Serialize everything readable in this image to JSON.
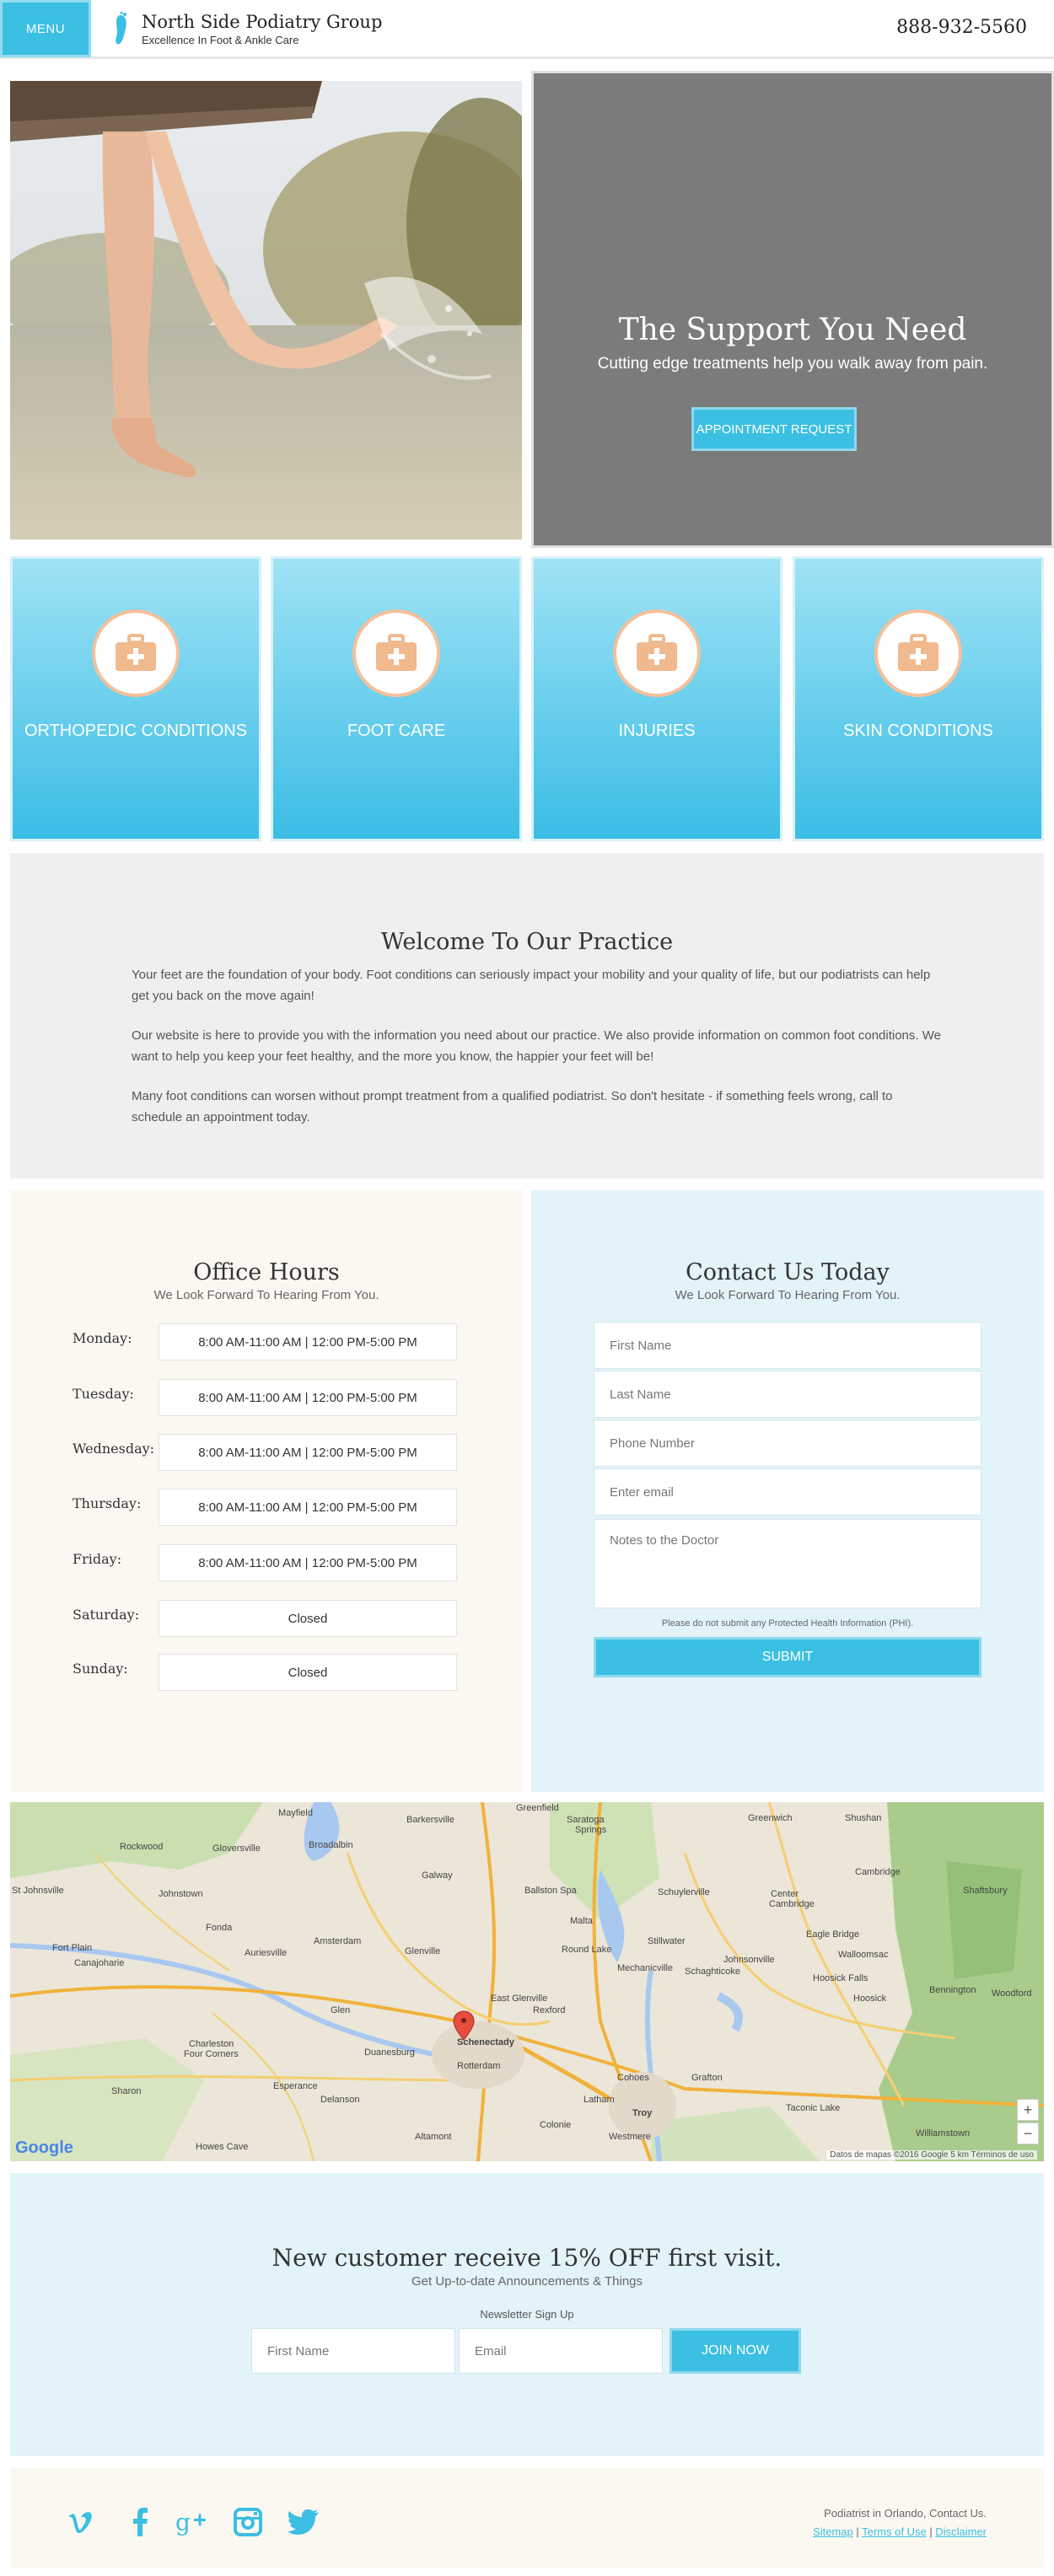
{
  "header": {
    "menu_label": "MENU",
    "brand_name": "North Side Podiatry Group",
    "tagline": "Excellence In Foot & Ankle Care",
    "phone": "888-932-5560"
  },
  "hero": {
    "title": "The Support You Need",
    "subtitle": "Cutting edge treatments help you walk away from pain.",
    "button_label": "APPOINTMENT REQUEST"
  },
  "services": [
    {
      "label": "ORTHOPEDIC CONDITIONS",
      "icon": "medical-kit-icon"
    },
    {
      "label": "FOOT CARE",
      "icon": "medical-kit-icon"
    },
    {
      "label": "INJURIES",
      "icon": "medical-kit-icon"
    },
    {
      "label": "SKIN CONDITIONS",
      "icon": "medical-kit-icon"
    }
  ],
  "welcome": {
    "title": "Welcome To Our Practice",
    "paragraphs": [
      "Your feet are the foundation of your body. Foot conditions can seriously impact your mobility and your quality of life, but our podiatrists can help get you back on the move again!",
      "Our website is here to provide you with the information you need about our practice. We also provide information on common foot conditions. We want to help you keep your feet healthy, and the more you know, the happier your feet will be!",
      "Many foot conditions can worsen without prompt treatment from a qualified podiatrist. So don't hesitate - if something feels wrong, call to schedule an appointment today."
    ]
  },
  "hours": {
    "title": "Office Hours",
    "subtitle": "We Look Forward To Hearing From You.",
    "days": [
      {
        "day": "Monday:",
        "time": "8:00 AM-11:00 AM | 12:00 PM-5:00 PM"
      },
      {
        "day": "Tuesday:",
        "time": "8:00 AM-11:00 AM | 12:00 PM-5:00 PM"
      },
      {
        "day": "Wednesday:",
        "time": "8:00 AM-11:00 AM | 12:00 PM-5:00 PM"
      },
      {
        "day": "Thursday:",
        "time": "8:00 AM-11:00 AM | 12:00 PM-5:00 PM"
      },
      {
        "day": "Friday:",
        "time": "8:00 AM-11:00 AM | 12:00 PM-5:00 PM"
      },
      {
        "day": "Saturday:",
        "time": "Closed"
      },
      {
        "day": "Sunday:",
        "time": "Closed"
      }
    ]
  },
  "contact": {
    "title": "Contact Us Today",
    "subtitle": "We Look Forward To Hearing From You.",
    "fields": {
      "first_name": "First Name",
      "last_name": "Last Name",
      "phone": "Phone Number",
      "email": "Enter email",
      "notes": "Notes to the Doctor"
    },
    "phi_note": "Please do not submit any Protected Health Information (PHI).",
    "submit_label": "SUBMIT"
  },
  "map": {
    "places": [
      "Mayfield",
      "Barkersville",
      "Greenfield",
      "Saratoga Springs",
      "Greenwich",
      "Shushan",
      "Rockwood",
      "Gloversville",
      "Broadalbin",
      "Galway",
      "Cambridge",
      "St Johnsville",
      "Johnstown",
      "Ballston Spa",
      "Schuylerville",
      "Center Cambridge",
      "Shaftsbury",
      "Fonda",
      "Amsterdam",
      "Glenville",
      "Malta",
      "Stillwater",
      "Eagle Bridge",
      "Fort Plain",
      "Canajoharie",
      "Auriesville",
      "Round Lake",
      "Mechanicville",
      "Schaghticoke",
      "Walloomsac",
      "Bennington",
      "Woodford",
      "East Glenville",
      "Rexford",
      "Johnsonville",
      "Hoosick Falls",
      "Hoosick",
      "Schenectady",
      "Rotterdam",
      "Troy",
      "Cohoes",
      "Latham",
      "Colonie",
      "Charleston Four Corners",
      "Esperance",
      "Delanson",
      "Grafton",
      "Taconic Lake",
      "Williamstown",
      "Sharon",
      "Altamont",
      "Howes Cave",
      "Westmere",
      "Duanesburg",
      "Glen"
    ],
    "attribution": "Datos de mapas ©2016 Google   5 km   Términos de uso",
    "zoom_in": "+",
    "zoom_out": "−",
    "google_label": "Google"
  },
  "newsletter": {
    "title": "New customer receive 15% OFF first visit.",
    "subtitle": "Get Up-to-date Announcements & Things",
    "signup_label": "Newsletter Sign Up",
    "first_name_placeholder": "First Name",
    "email_placeholder": "Email",
    "join_label": "JOIN NOW"
  },
  "footer": {
    "text": "Podiatrist in Orlando, Contact Us.",
    "links": [
      "Sitemap",
      "Terms of Use",
      "Disclaimer"
    ],
    "social": [
      "vimeo-icon",
      "facebook-icon",
      "google-plus-icon",
      "instagram-icon",
      "twitter-icon"
    ]
  },
  "colors": {
    "accent": "#3bbfe3",
    "hero_panel": "#7b7b7b",
    "icon_ring": "#f4c09a",
    "light_blue_bg": "#e2f3fa",
    "cream_bg": "#fbf8f2"
  }
}
